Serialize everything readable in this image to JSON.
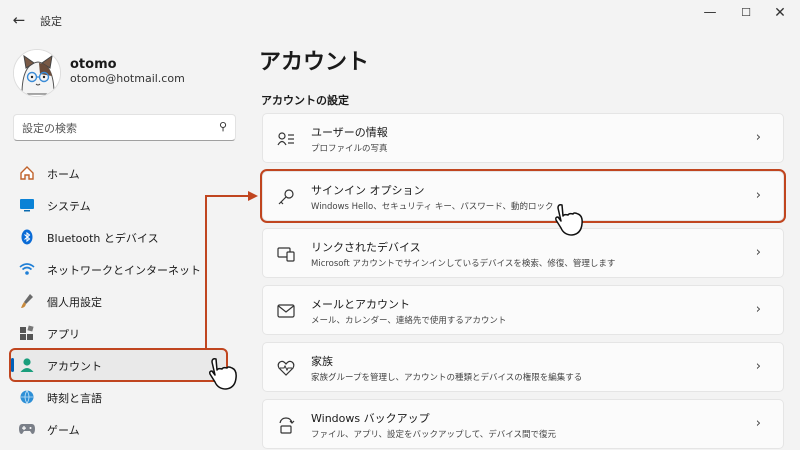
{
  "window": {
    "title": "設定",
    "back_icon": "back-arrow-icon",
    "minimize_icon": "minimize-icon",
    "maximize_icon": "maximize-icon",
    "close_icon": "close-icon"
  },
  "user": {
    "name": "otomo",
    "email": "otomo@hotmail.com"
  },
  "search": {
    "placeholder": "設定の検索"
  },
  "sidebar": {
    "items": [
      {
        "label": "ホーム",
        "icon": "home-icon"
      },
      {
        "label": "システム",
        "icon": "system-icon"
      },
      {
        "label": "Bluetooth とデバイス",
        "icon": "bluetooth-icon"
      },
      {
        "label": "ネットワークとインターネット",
        "icon": "wifi-icon"
      },
      {
        "label": "個人用設定",
        "icon": "brush-icon"
      },
      {
        "label": "アプリ",
        "icon": "apps-icon"
      },
      {
        "label": "アカウント",
        "icon": "account-icon",
        "selected": true
      },
      {
        "label": "時刻と言語",
        "icon": "globe-clock-icon"
      },
      {
        "label": "ゲーム",
        "icon": "gamepad-icon"
      }
    ]
  },
  "main": {
    "page_title": "アカウント",
    "section_title": "アカウントの設定",
    "cards": [
      {
        "title": "ユーザーの情報",
        "desc": "プロファイルの写真",
        "icon": "user-info-icon"
      },
      {
        "title": "サインイン オプション",
        "desc": "Windows Hello、セキュリティ キー、パスワード、動的ロック",
        "icon": "key-icon",
        "highlighted": true
      },
      {
        "title": "リンクされたデバイス",
        "desc": "Microsoft アカウントでサインインしているデバイスを検索、修復、管理します",
        "icon": "linked-devices-icon"
      },
      {
        "title": "メールとアカウント",
        "desc": "メール、カレンダー、連絡先で使用するアカウント",
        "icon": "mail-icon"
      },
      {
        "title": "家族",
        "desc": "家族グループを管理し、アカウントの種類とデバイスの権限を編集する",
        "icon": "family-heart-icon"
      },
      {
        "title": "Windows バックアップ",
        "desc": "ファイル、アプリ、設定をバックアップして、デバイス間で復元",
        "icon": "backup-icon"
      }
    ]
  },
  "colors": {
    "accent": "#005fb8",
    "highlight": "#c0451f",
    "background": "#f3f3f3",
    "card": "#fbfbfb"
  }
}
